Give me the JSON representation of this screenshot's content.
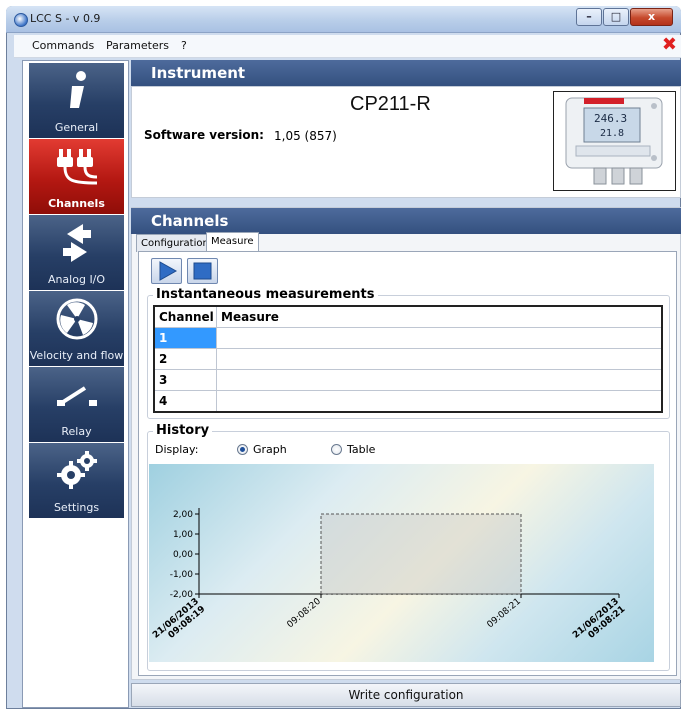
{
  "window": {
    "title": "LCC S - v 0.9",
    "close_glyph": "x",
    "maximize_glyph": "□",
    "minimize_glyph": "–"
  },
  "menu": {
    "items": [
      "Commands",
      "Parameters",
      "?"
    ],
    "close_glyph": "✖"
  },
  "nav": {
    "items": [
      {
        "label": "General",
        "icon": "info-icon"
      },
      {
        "label": "Channels",
        "icon": "plugs-icon",
        "active": true
      },
      {
        "label": "Analog I/O",
        "icon": "arrows-icon"
      },
      {
        "label": "Velocity and flow",
        "icon": "fan-icon"
      },
      {
        "label": "Relay",
        "icon": "switch-icon"
      },
      {
        "label": "Settings",
        "icon": "gears-icon"
      }
    ]
  },
  "instrument": {
    "header": "Instrument",
    "model": "CP211-R",
    "software_label": "Software version:",
    "software_value": "1,05 (857)",
    "device_display": {
      "line1": "246.3",
      "line2": "21.8"
    }
  },
  "channels": {
    "header": "Channels",
    "tabs": [
      "Configuration",
      "Measure"
    ],
    "selected_tab": "Measure",
    "instantaneous_title": "Instantaneous measurements",
    "table": {
      "columns": [
        "Channel",
        "Measure"
      ],
      "rows": [
        {
          "channel": "1",
          "measure": ""
        },
        {
          "channel": "2",
          "measure": ""
        },
        {
          "channel": "3",
          "measure": ""
        },
        {
          "channel": "4",
          "measure": ""
        }
      ],
      "selected_row": 0
    },
    "history": {
      "title": "History",
      "display_label": "Display:",
      "options": [
        "Graph",
        "Table"
      ],
      "selected": "Graph"
    }
  },
  "chart_data": {
    "type": "line",
    "y_ticks": [
      "2,00",
      "1,00",
      "0,00",
      "-1,00",
      "-2,00"
    ],
    "ylim": [
      -2,
      2
    ],
    "x_tick_labels": [
      {
        "line1": "21/06/2013",
        "line2": "09:08:19"
      },
      {
        "line1": "09:08:20",
        "line2": ""
      },
      {
        "line1": "09:08:21",
        "line2": ""
      },
      {
        "line1": "21/06/2013",
        "line2": "09:08:21"
      }
    ],
    "series": []
  },
  "footer": {
    "write_label": "Write configuration"
  }
}
